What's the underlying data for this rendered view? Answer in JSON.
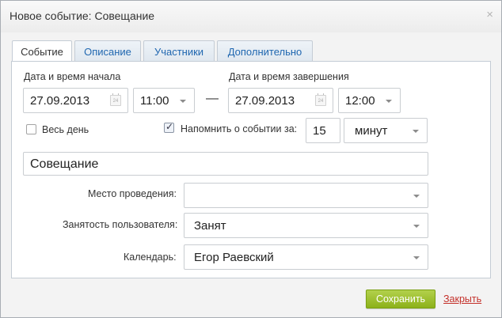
{
  "dialog": {
    "title": "Новое событие: Совещание",
    "close_glyph": "×"
  },
  "tabs": [
    {
      "label": "Событие",
      "active": true
    },
    {
      "label": "Описание",
      "active": false
    },
    {
      "label": "Участники",
      "active": false
    },
    {
      "label": "Дополнительно",
      "active": false
    }
  ],
  "start": {
    "label": "Дата и время начала",
    "date": "27.09.2013",
    "time": "11:00"
  },
  "dash": "—",
  "end": {
    "label": "Дата и время завершения",
    "date": "27.09.2013",
    "time": "12:00"
  },
  "calendar_icon_text": "24",
  "all_day": {
    "label": "Весь день",
    "checked": false
  },
  "remind": {
    "label": "Напомнить о событии за:",
    "checked": true,
    "value": "15",
    "unit": "минут"
  },
  "event_name": "Совещание",
  "location": {
    "label": "Место проведения:",
    "value": ""
  },
  "busy": {
    "label": "Занятость пользователя:",
    "value": "Занят"
  },
  "calendar": {
    "label": "Календарь:",
    "value": "Егор Раевский"
  },
  "buttons": {
    "save": "Сохранить",
    "cancel": "Закрыть"
  },
  "colors": {
    "tab_link": "#2067b0",
    "save_button": "#9cc02c",
    "cancel_link": "#c4312b"
  }
}
